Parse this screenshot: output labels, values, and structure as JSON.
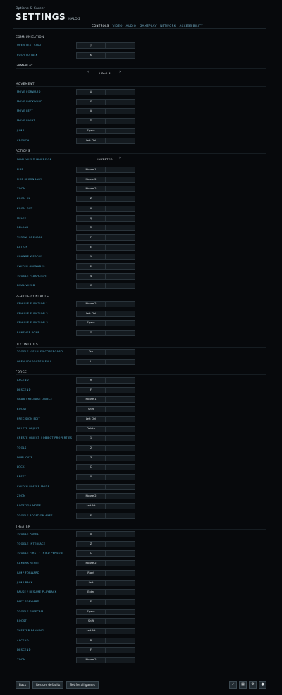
{
  "header": {
    "breadcrumb": "Options & Career",
    "title": "SETTINGS",
    "game": "HALO 2"
  },
  "tabs": [
    "CONTROLS",
    "VIDEO",
    "AUDIO",
    "GAMEPLAY",
    "NETWORK",
    "ACCESSIBILITY"
  ],
  "communication": {
    "title": "COMMUNICATION",
    "rows": [
      {
        "label": "OPEN TEXT CHAT",
        "key": "J"
      },
      {
        "label": "PUSH TO TALK",
        "key": "K"
      }
    ]
  },
  "gameplay": {
    "title": "GAMEPLAY",
    "value": "HALO 2"
  },
  "movement": {
    "title": "MOVEMENT",
    "rows": [
      {
        "label": "MOVE FORWARD",
        "key": "W"
      },
      {
        "label": "MOVE BACKWARD",
        "key": "S"
      },
      {
        "label": "MOVE LEFT",
        "key": "A"
      },
      {
        "label": "MOVE RIGHT",
        "key": "D"
      },
      {
        "label": "JUMP",
        "key": "Space"
      },
      {
        "label": "CROUCH",
        "key": "Left Ctrl"
      }
    ]
  },
  "actions": {
    "title": "ACTIONS",
    "dual_wield": {
      "label": "DUAL WIELD INVERSION",
      "value": "INVERTED"
    },
    "rows": [
      {
        "label": "FIRE",
        "key": "Mouse 1"
      },
      {
        "label": "FIRE SECONDARY",
        "key": "Mouse 2"
      },
      {
        "label": "ZOOM",
        "key": "Mouse 2"
      },
      {
        "label": "ZOOM IN",
        "key": "Z"
      },
      {
        "label": "ZOOM OUT",
        "key": "X"
      },
      {
        "label": "MELEE",
        "key": "Q"
      },
      {
        "label": "RELOAD",
        "key": "R"
      },
      {
        "label": "THROW GRENADE",
        "key": "F"
      },
      {
        "label": "ACTION",
        "key": "E"
      },
      {
        "label": "CHANGE WEAPON",
        "key": "1"
      },
      {
        "label": "SWITCH GRENADES",
        "key": "2"
      },
      {
        "label": "TOGGLE FLASHLIGHT",
        "key": "4"
      },
      {
        "label": "DUAL WIELD",
        "key": "C"
      }
    ]
  },
  "vehicle": {
    "title": "VEHICLE CONTROLS",
    "rows": [
      {
        "label": "VEHICLE FUNCTION 1",
        "key": "Mouse 2"
      },
      {
        "label": "VEHICLE FUNCTION 2",
        "key": "Left Ctrl"
      },
      {
        "label": "VEHICLE FUNCTION 3",
        "key": "Space"
      },
      {
        "label": "BANSHEE BOMB",
        "key": "G"
      }
    ]
  },
  "ui": {
    "title": "UI CONTROLS",
    "rows": [
      {
        "label": "TOGGLE VISUALS/SCOREBOARD",
        "key": "Tab"
      },
      {
        "label": "OPEN LOADOUTS MENU",
        "key": "L"
      }
    ]
  },
  "forge": {
    "title": "FORGE",
    "rows": [
      {
        "label": "ASCEND",
        "key": "R"
      },
      {
        "label": "DESCEND",
        "key": "F"
      },
      {
        "label": "GRAB / RELEASE OBJECT",
        "key": "Mouse 1"
      },
      {
        "label": "BOOST",
        "key": "Shift"
      },
      {
        "label": "PRECISION EDIT",
        "key": "Left Ctrl"
      },
      {
        "label": "DELETE OBJECT",
        "key": "Delete"
      },
      {
        "label": "CREATE OBJECT / OBJECT PROPERTIES",
        "key": "1"
      },
      {
        "label": "TOOLS",
        "key": "2"
      },
      {
        "label": "DUPLICATE",
        "key": "3"
      },
      {
        "label": "LOCK",
        "key": "C"
      },
      {
        "label": "RESET",
        "key": "X"
      },
      {
        "label": "SWITCH PLAYER MODE",
        "key": "-"
      },
      {
        "label": "ZOOM",
        "key": "Mouse 2"
      },
      {
        "label": "ROTATION MODE",
        "key": "Left Alt"
      },
      {
        "label": "TOGGLE ROTATION AXES",
        "key": "E"
      }
    ]
  },
  "theater": {
    "title": "THEATER",
    "rows": [
      {
        "label": "TOGGLE PANEL",
        "key": "X"
      },
      {
        "label": "TOGGLE INTERFACE",
        "key": "Z"
      },
      {
        "label": "TOGGLE FIRST / THIRD PERSON",
        "key": "C"
      },
      {
        "label": "CAMERA RESET",
        "key": "Mouse 2"
      },
      {
        "label": "JUMP FORWARD",
        "key": "Right"
      },
      {
        "label": "JUMP BACK",
        "key": "Left"
      },
      {
        "label": "PAUSE / RESUME PLAYBACK",
        "key": "Enter"
      },
      {
        "label": "FAST FORWARD",
        "key": "E"
      },
      {
        "label": "TOGGLE FREECAM",
        "key": "Space"
      },
      {
        "label": "BOOST",
        "key": "Shift"
      },
      {
        "label": "THEATER PANNING",
        "key": "Left Alt"
      },
      {
        "label": "ASCEND",
        "key": "R"
      },
      {
        "label": "DESCEND",
        "key": "F"
      },
      {
        "label": "ZOOM",
        "key": "Mouse 2"
      }
    ]
  },
  "footer": {
    "back": "Back",
    "restore": "Restore defaults",
    "set_all": "Set for all games"
  },
  "icons": [
    "check-icon",
    "grid-icon",
    "gear-icon",
    "chat-icon"
  ],
  "colors": {
    "accent": "#3bc4e8",
    "label": "#57b5d6",
    "background": "#07090c"
  }
}
